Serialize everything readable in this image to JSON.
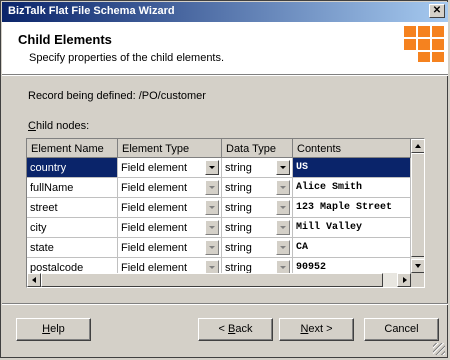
{
  "window": {
    "title": "BizTalk Flat File Schema Wizard"
  },
  "header": {
    "title": "Child Elements",
    "subtitle": "Specify properties of the child elements."
  },
  "record": {
    "label": "Record being defined:",
    "path": "/PO/customer"
  },
  "child_nodes": {
    "label_prefix": "C",
    "label_rest": "hild nodes:"
  },
  "grid": {
    "columns": [
      "Element Name",
      "Element Type",
      "Data Type",
      "Contents"
    ],
    "rows": [
      {
        "name": "country",
        "element_type": "Field element",
        "data_type": "string",
        "contents": "US",
        "selected": true
      },
      {
        "name": "fullName",
        "element_type": "Field element",
        "data_type": "string",
        "contents": "Alice Smith"
      },
      {
        "name": "street",
        "element_type": "Field element",
        "data_type": "string",
        "contents": "123 Maple Street"
      },
      {
        "name": "city",
        "element_type": "Field element",
        "data_type": "string",
        "contents": "Mill Valley"
      },
      {
        "name": "state",
        "element_type": "Field element",
        "data_type": "string",
        "contents": "CA"
      },
      {
        "name": "postalcode",
        "element_type": "Field element",
        "data_type": "string",
        "contents": "90952"
      }
    ]
  },
  "buttons": {
    "help": {
      "accel": "H",
      "rest": "elp"
    },
    "back": {
      "prefix": "< ",
      "accel": "B",
      "rest": "ack"
    },
    "next": {
      "accel": "N",
      "rest": "ext >"
    },
    "cancel": "Cancel"
  },
  "icons": {
    "close": "close-icon",
    "logo": "biztalk-logo-icon"
  },
  "colors": {
    "selection": "#0a246a",
    "logo": "#f5821f",
    "titlebar_start": "#0a246a",
    "titlebar_end": "#a6caf0"
  }
}
